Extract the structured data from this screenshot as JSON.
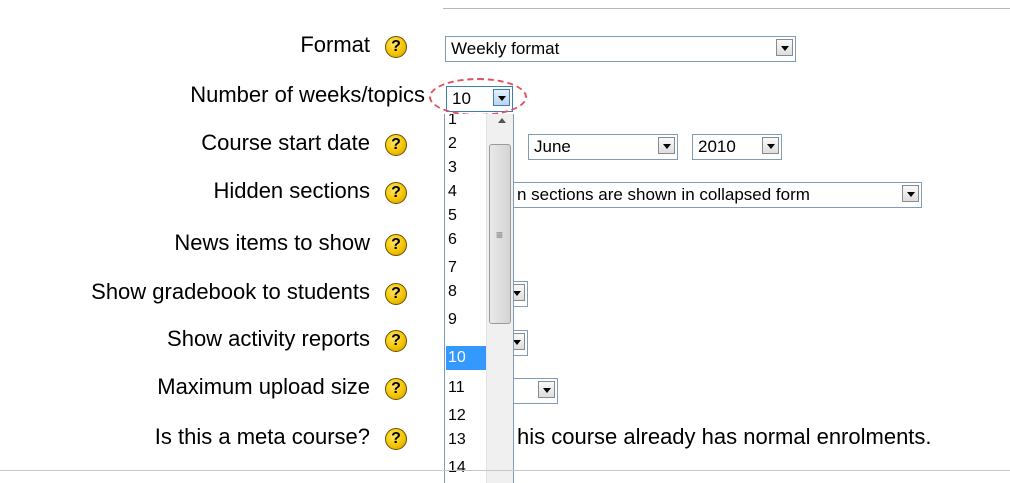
{
  "form": {
    "fields": [
      {
        "label": "Format",
        "help_icon": "help-question-icon"
      },
      {
        "label": "Number of weeks/topics"
      },
      {
        "label": "Course start date",
        "help_icon": "help-question-icon"
      },
      {
        "label": "Hidden sections",
        "help_icon": "help-question-icon"
      },
      {
        "label": "News items to show",
        "help_icon": "help-question-icon"
      },
      {
        "label": "Show gradebook to students",
        "help_icon": "help-question-icon"
      },
      {
        "label": "Show activity reports",
        "help_icon": "help-question-icon"
      },
      {
        "label": "Maximum upload size",
        "help_icon": "help-question-icon"
      },
      {
        "label": "Is this a meta course?",
        "help_icon": "help-question-icon"
      }
    ],
    "help_glyph": "?",
    "format_value": "Weekly format",
    "weeks_value": "10",
    "start_month": "June",
    "start_year": "2010",
    "hidden_sections_value": "n sections are shown in collapsed form",
    "meta_course_text": "his course already has normal enrolments."
  },
  "weeks_dropdown": {
    "options": [
      "1",
      "2",
      "3",
      "4",
      "5",
      "6",
      "7",
      "8",
      "9",
      "10",
      "11",
      "12",
      "13",
      "14"
    ],
    "selected": "10",
    "scrollbar_grip": "≡"
  },
  "colors": {
    "selected_highlight": "#3399ff",
    "annotation_circle": "#e05060",
    "help_icon": "#f5c400"
  }
}
